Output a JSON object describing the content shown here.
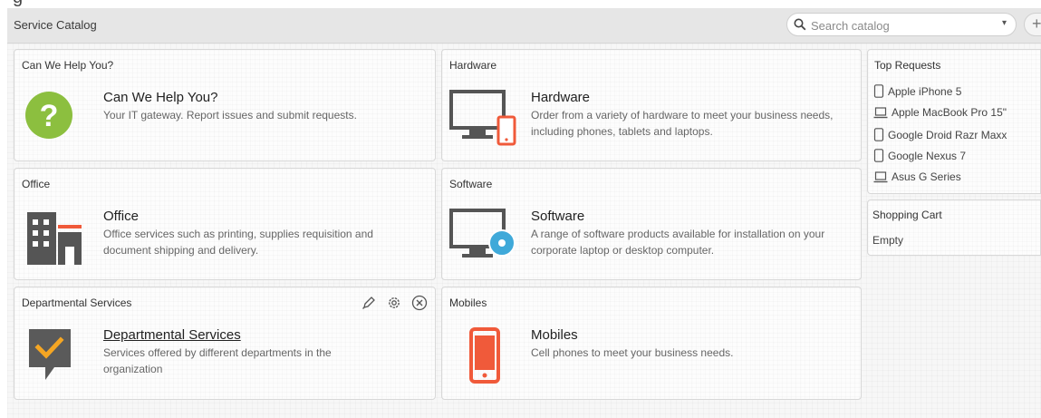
{
  "page_title": "Service Catalog",
  "search": {
    "placeholder": "Search catalog",
    "caret": "▾"
  },
  "add_label": "+",
  "categories": [
    {
      "header": "Can We Help You?",
      "title": "Can We Help You?",
      "description": "Your IT gateway. Report issues and submit requests."
    },
    {
      "header": "Hardware",
      "title": "Hardware",
      "description": "Order from a variety of hardware to meet your business needs, including phones, tablets and laptops."
    },
    {
      "header": "Office",
      "title": "Office",
      "description": "Office services such as printing, supplies requisition and document shipping and delivery."
    },
    {
      "header": "Software",
      "title": "Software",
      "description": "A range of software products available for installation on your corporate laptop or desktop computer."
    },
    {
      "header": "Departmental Services",
      "title": "Departmental Services",
      "description": "Services offered by different departments in the organization"
    },
    {
      "header": "Mobiles",
      "title": "Mobiles",
      "description": "Cell phones to meet your business needs."
    }
  ],
  "top_requests": {
    "header": "Top Requests",
    "items": [
      {
        "label": "Apple iPhone 5",
        "icon": "phone-icon"
      },
      {
        "label": "Apple MacBook Pro 15\"",
        "icon": "laptop-icon"
      },
      {
        "label": "Google Droid Razr Maxx",
        "icon": "phone-icon"
      },
      {
        "label": "Google Nexus 7",
        "icon": "phone-icon"
      },
      {
        "label": "Asus G Series",
        "icon": "laptop-icon"
      }
    ]
  },
  "shopping_cart": {
    "header": "Shopping Cart",
    "status": "Empty"
  },
  "colors": {
    "help_green": "#8cbf3f",
    "accent_orange": "#f05a3a",
    "software_blue": "#3fa9d9",
    "check_yellow": "#f5a623",
    "icon_gray": "#555555"
  }
}
